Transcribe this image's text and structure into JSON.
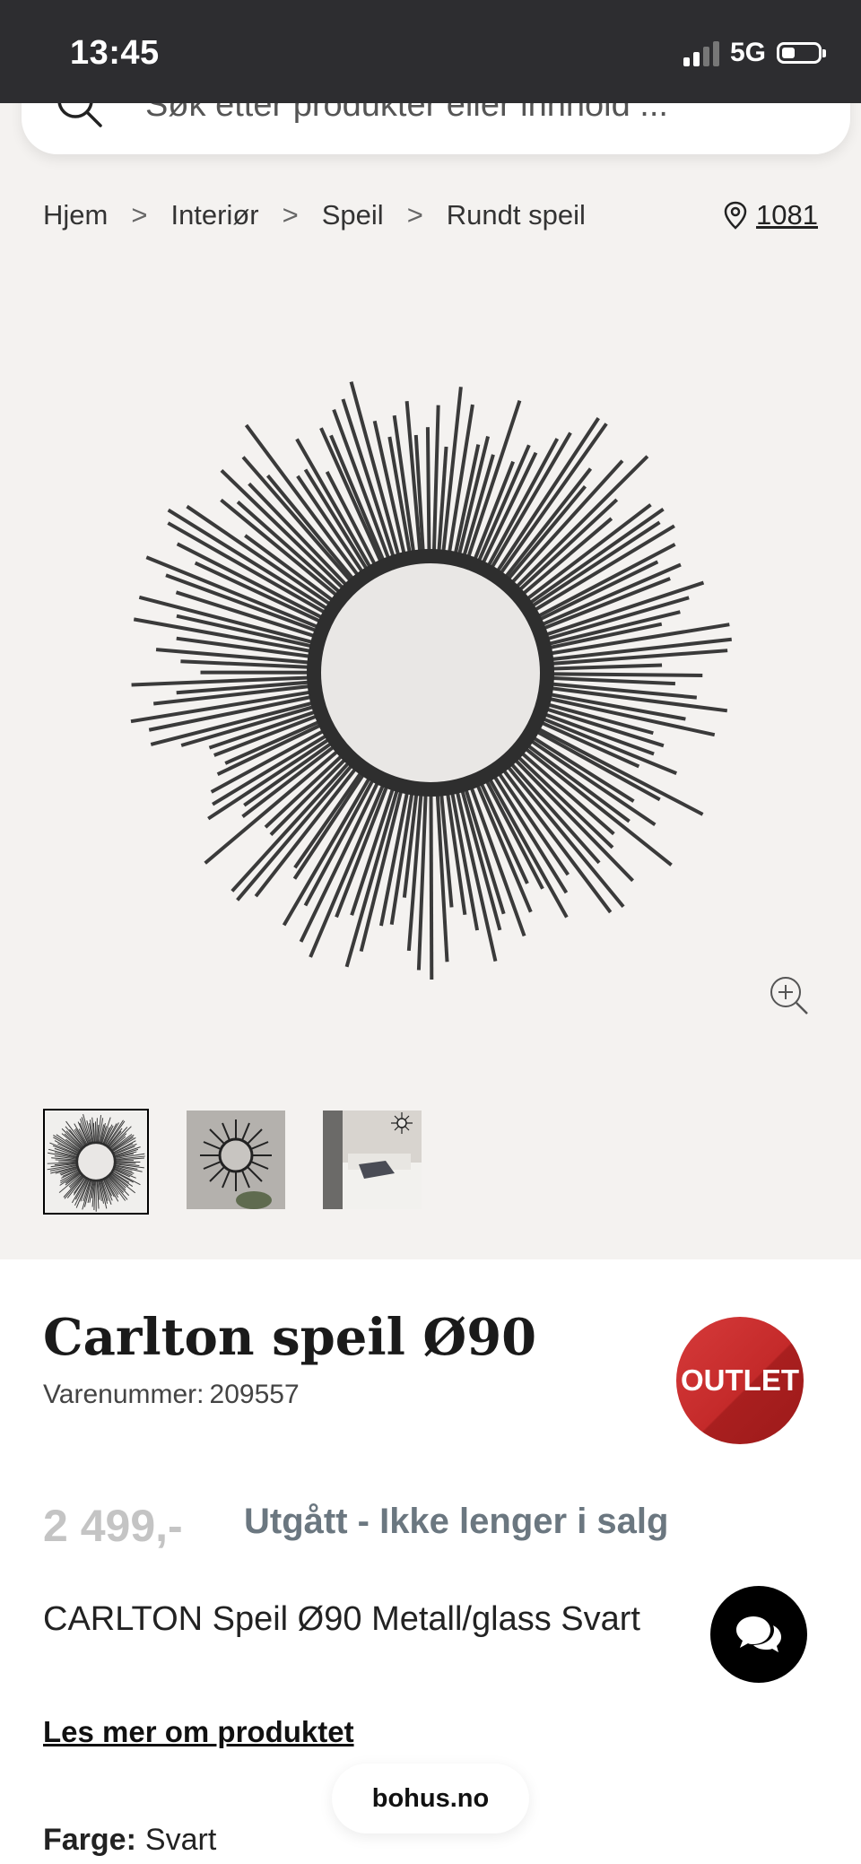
{
  "status_bar": {
    "time": "13:45",
    "network": "5G"
  },
  "search": {
    "placeholder": "Søk etter produkter eller innhold ..."
  },
  "breadcrumb": {
    "items": [
      {
        "label": "Hjem"
      },
      {
        "label": "Interiør"
      },
      {
        "label": "Speil"
      },
      {
        "label": "Rundt speil"
      }
    ],
    "separator": ">"
  },
  "store": {
    "code": "1081",
    "icon": "location-pin-icon"
  },
  "gallery": {
    "thumbnail_count": 3,
    "active_index": 0
  },
  "product": {
    "title": "Carlton speil Ø90",
    "sku_label": "Varenummer:",
    "sku": "209557",
    "badge": "OUTLET",
    "price": "2 499,-",
    "status": "Utgått - Ikke lenger i salg",
    "description": "CARLTON Speil Ø90 Metall/glass Svart",
    "read_more": "Les mer om produktet",
    "color_label": "Farge:",
    "color_value": "Svart"
  },
  "footer_pill": {
    "label": "bohus.no"
  },
  "colors": {
    "status_bar_bg": "#2d2d30",
    "badge_red": "#c42a2a",
    "page_bg": "#f4f2f0"
  }
}
